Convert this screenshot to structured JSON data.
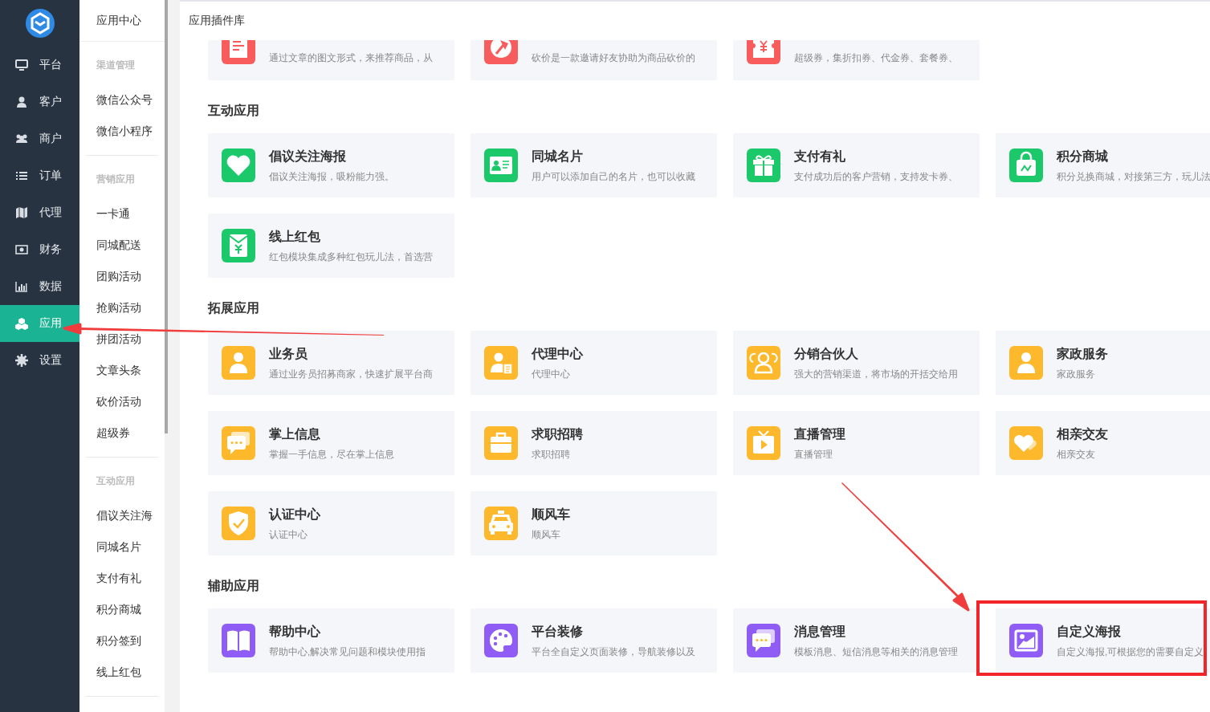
{
  "nav": {
    "items": [
      {
        "label": "平台",
        "selected": false
      },
      {
        "label": "客户",
        "selected": false
      },
      {
        "label": "商户",
        "selected": false
      },
      {
        "label": "订单",
        "selected": false
      },
      {
        "label": "代理",
        "selected": false
      },
      {
        "label": "财务",
        "selected": false
      },
      {
        "label": "数据",
        "selected": false
      },
      {
        "label": "应用",
        "selected": true
      },
      {
        "label": "设置",
        "selected": false
      }
    ]
  },
  "submenu": {
    "title": "应用中心",
    "groups": [
      {
        "title": "渠道管理",
        "items": [
          "微信公众号",
          "微信小程序"
        ]
      },
      {
        "title": "营销应用",
        "items": [
          "一卡通",
          "同城配送",
          "团购活动",
          "抢购活动",
          "拼团活动",
          "文章头条",
          "砍价活动",
          "超级券"
        ]
      },
      {
        "title": "互动应用",
        "items": [
          "倡议关注海",
          "同城名片",
          "支付有礼",
          "积分商城",
          "积分签到",
          "线上红包"
        ]
      }
    ]
  },
  "main": {
    "title": "应用插件库",
    "partial_row": {
      "color": "#f95c5c",
      "cards": [
        {
          "desc": "通过文章的图文形式，来推荐商品，从"
        },
        {
          "desc": "砍价是一款邀请好友协助为商品砍价的"
        },
        {
          "desc": "超级券，集折扣券、代金券、套餐券、"
        }
      ]
    },
    "sections": [
      {
        "title": "互动应用",
        "color": "#1bc96a",
        "cards": [
          {
            "title": "倡议关注海报",
            "desc": "倡议关注海报，吸粉能力强。",
            "highlighted": false
          },
          {
            "title": "同城名片",
            "desc": "用户可以添加自己的名片，也可以收藏",
            "highlighted": false
          },
          {
            "title": "支付有礼",
            "desc": "支付成功后的客户营销，支持发卡券、",
            "highlighted": false
          },
          {
            "title": "积分商城",
            "desc": "积分兑换商城，对接第三方，玩儿法",
            "highlighted": false
          },
          {
            "title": "线上红包",
            "desc": "红包模块集成多种红包玩儿法，首选营",
            "highlighted": false
          }
        ]
      },
      {
        "title": "拓展应用",
        "color": "#fdb92b",
        "cards": [
          {
            "title": "业务员",
            "desc": "通过业务员招募商家，快速扩展平台商",
            "highlighted": false
          },
          {
            "title": "代理中心",
            "desc": "代理中心",
            "highlighted": false
          },
          {
            "title": "分销合伙人",
            "desc": "强大的营销渠道，将市场的开括交给用",
            "highlighted": false
          },
          {
            "title": "家政服务",
            "desc": "家政服务",
            "highlighted": false
          },
          {
            "title": "掌上信息",
            "desc": "掌握一手信息，尽在掌上信息",
            "highlighted": false
          },
          {
            "title": "求职招聘",
            "desc": "求职招聘",
            "highlighted": false
          },
          {
            "title": "直播管理",
            "desc": "直播管理",
            "highlighted": false
          },
          {
            "title": "相亲交友",
            "desc": "相亲交友",
            "highlighted": false
          },
          {
            "title": "认证中心",
            "desc": "认证中心",
            "highlighted": false
          },
          {
            "title": "顺风车",
            "desc": "顺风车",
            "highlighted": false
          }
        ]
      },
      {
        "title": "辅助应用",
        "color": "#8f5cf5",
        "cards": [
          {
            "title": "帮助中心",
            "desc": "帮助中心,解决常见问题和模块使用指",
            "highlighted": false
          },
          {
            "title": "平台装修",
            "desc": "平台全自定义页面装修，导航装修以及",
            "highlighted": false
          },
          {
            "title": "消息管理",
            "desc": "模板消息、短信消息等相关的消息管理",
            "highlighted": false
          },
          {
            "title": "自定义海报",
            "desc": "自定义海报,可根据您的需要自定义",
            "highlighted": true
          }
        ]
      }
    ]
  }
}
